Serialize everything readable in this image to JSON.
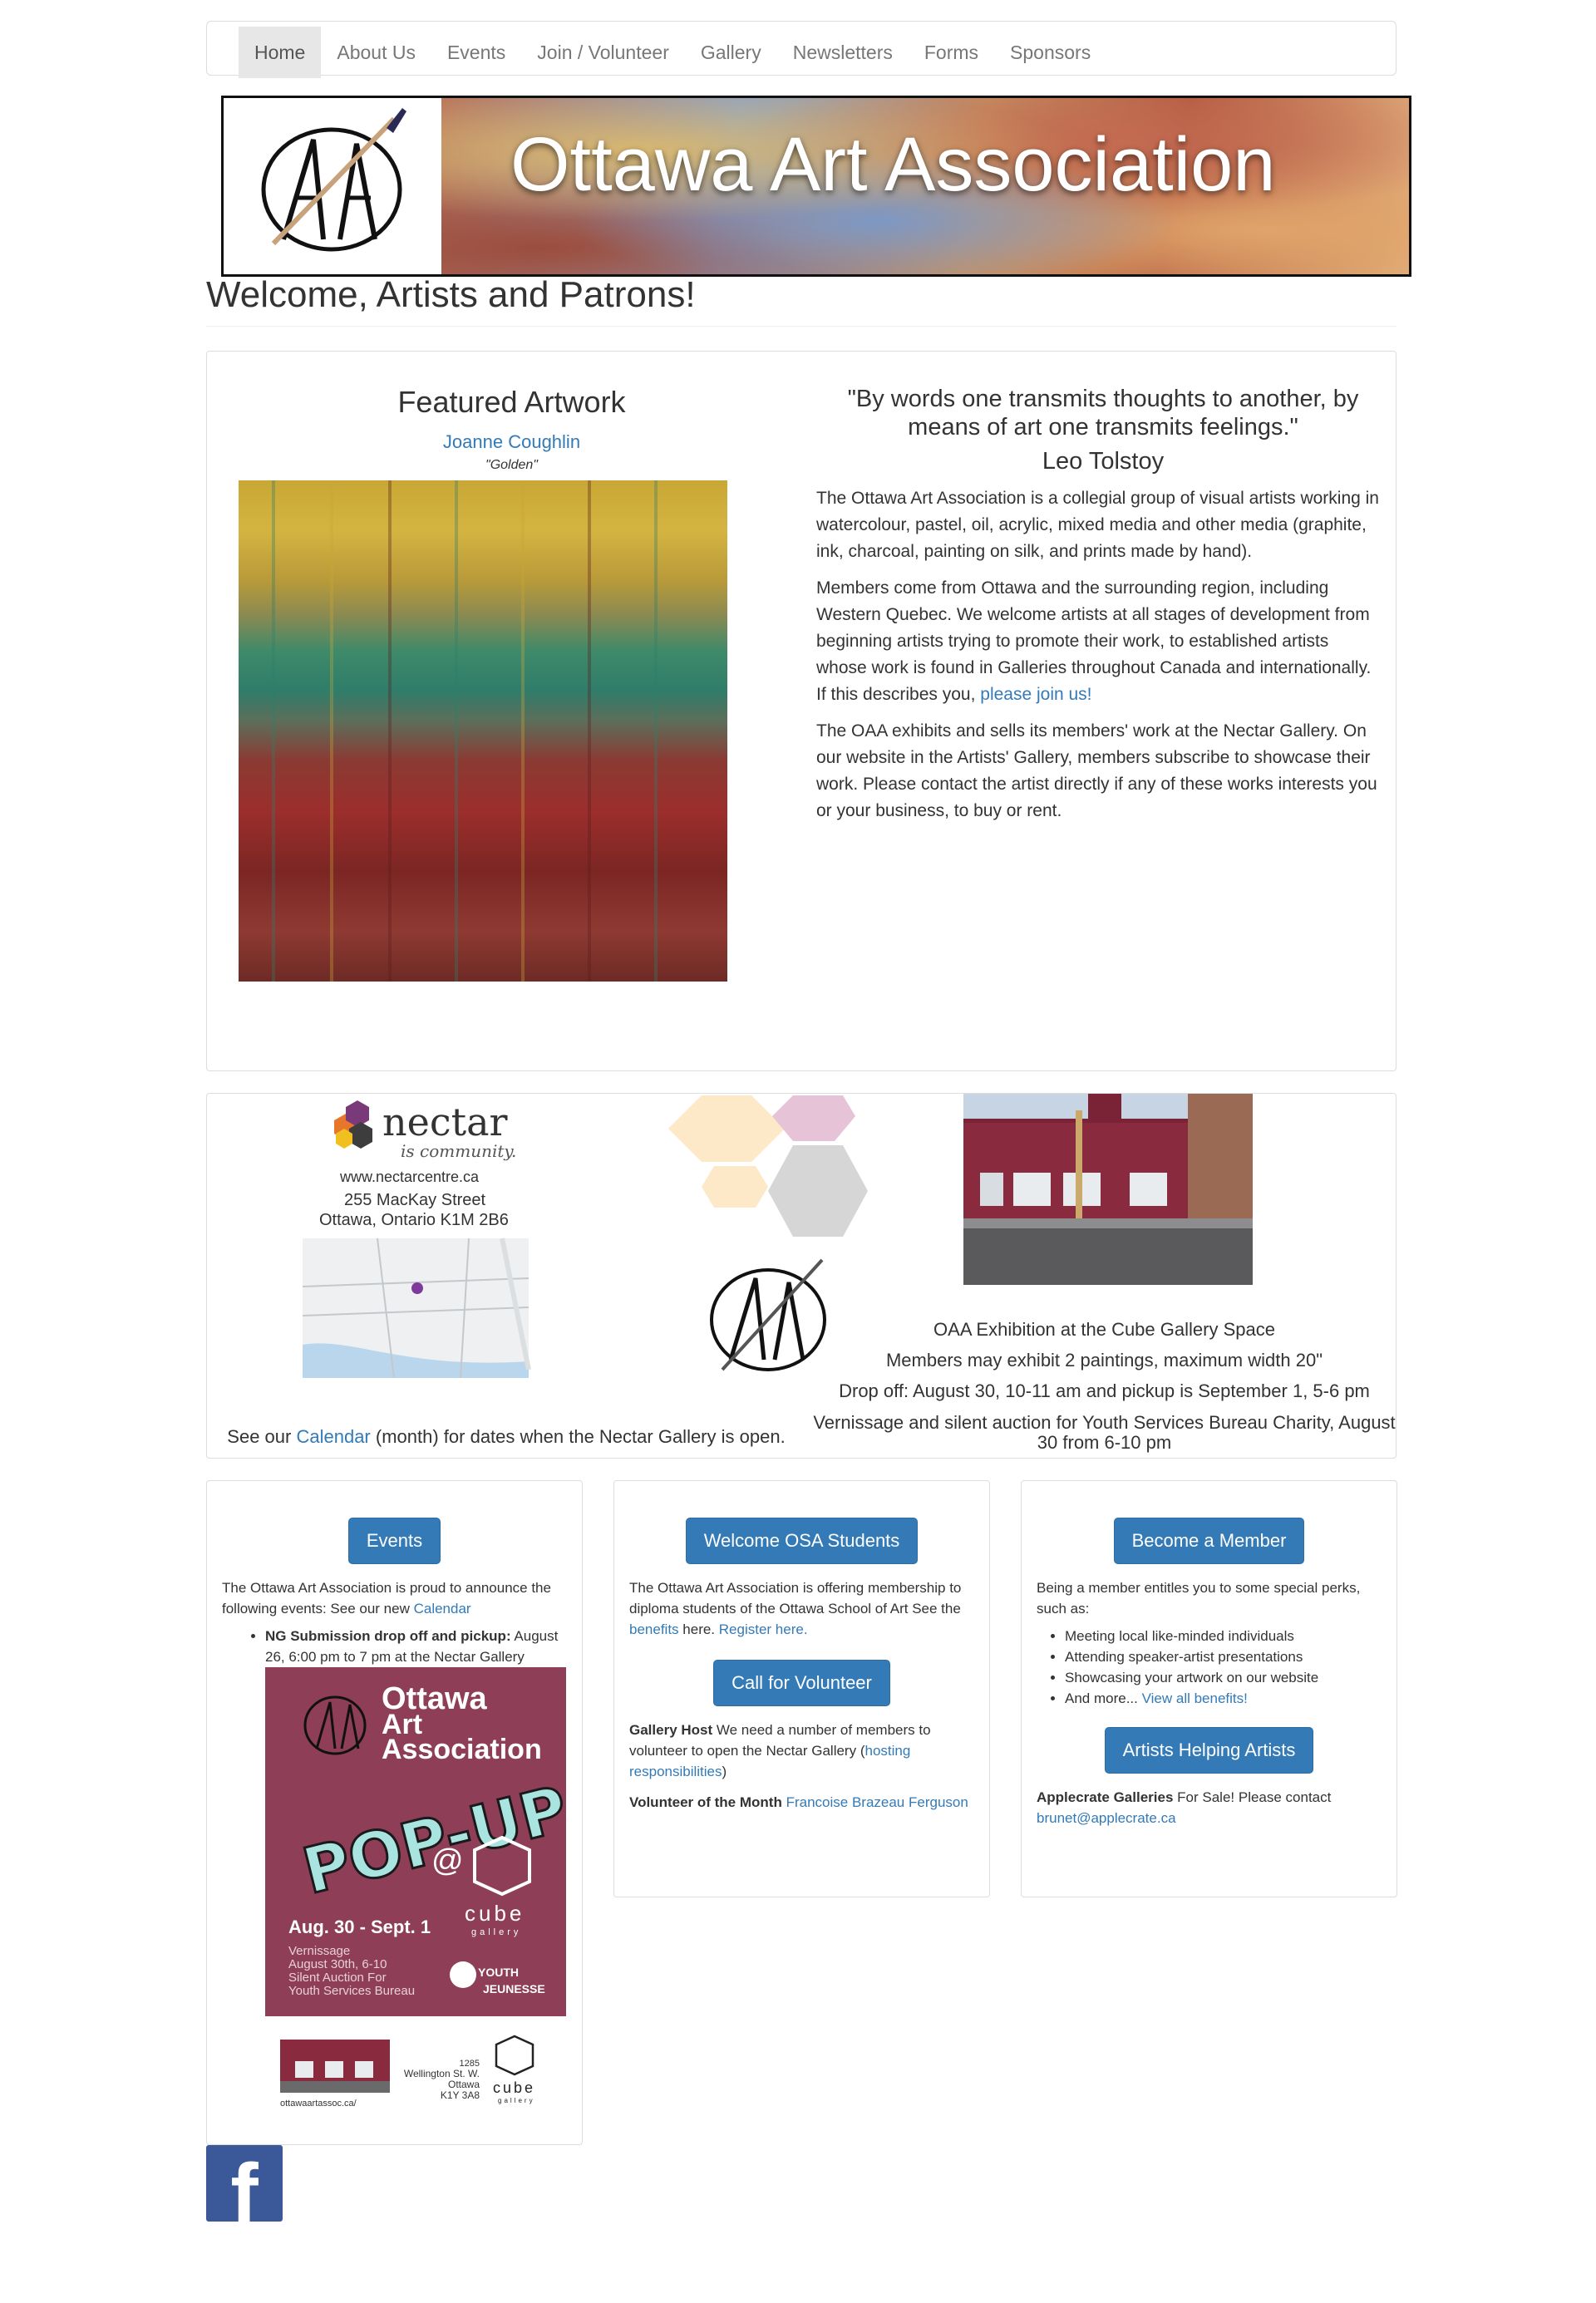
{
  "nav": {
    "items": [
      {
        "label": "Home"
      },
      {
        "label": "About Us"
      },
      {
        "label": "Events"
      },
      {
        "label": "Join / Volunteer"
      },
      {
        "label": "Gallery"
      },
      {
        "label": "Newsletters"
      },
      {
        "label": "Forms"
      },
      {
        "label": "Sponsors"
      }
    ],
    "active": "Home"
  },
  "banner": {
    "title": "Ottawa Art Association"
  },
  "page": {
    "title": "Welcome, Artists and Patrons!"
  },
  "featured": {
    "heading": "Featured Artwork",
    "artist": "Joanne Coughlin",
    "art_title": "\"Golden\""
  },
  "quote": {
    "text": "\"By words one transmits thoughts to another, by means of art one transmits feelings.\"",
    "author": "Leo Tolstoy"
  },
  "about": {
    "p1": "The Ottawa Art Association is a collegial group of visual artists working in watercolour, pastel, oil, acrylic, mixed media and other media (graphite, ink, charcoal, painting on silk, and prints made by hand).",
    "p2": "Members come from Ottawa and the surrounding region, including Western Quebec. We welcome artists at all stages of development from beginning artists trying to promote their work, to established artists whose work is found in Galleries throughout Canada and internationally. If this describes you,",
    "p2_link": "please join us!",
    "p3": "The OAA exhibits and sells its members' work at the Nectar Gallery. On our website in the Artists' Gallery, members subscribe to showcase their work. Please contact the artist directly if any of these works interests you or your business, to buy or rent."
  },
  "nectar": {
    "brand": "nectar",
    "tagline": "is community.",
    "url": "www.nectarcentre.ca",
    "street": "255 MacKay Street",
    "city": "Ottawa, Ontario  K1M 2B6",
    "caption_pre": "See our",
    "caption_link": "Calendar",
    "caption_post": "(month) for dates when the Nectar Gallery is open."
  },
  "cube": {
    "line1": "OAA Exhibition at the Cube Gallery Space",
    "line2": "Members may exhibit 2 paintings, maximum width 20\"",
    "line3": "Drop off: August 30, 10-11 am and pickup is September 1, 5-6 pm",
    "line4": "Vernissage and silent auction for Youth Services Bureau Charity, August 30 from 6-10 pm"
  },
  "events": {
    "button": "Events",
    "text": "The Ottawa Art Association is proud to announce the following events: See our new",
    "calendar_link": "Calendar",
    "item_bold": "NG Submission drop off and pickup:",
    "item_rest": "August 26, 6:00 pm to 7 pm at the Nectar Gallery",
    "poster": {
      "title_line1": "Ottawa",
      "title_line2": "Art",
      "title_line3": "Association",
      "popup": "POP-UP",
      "at": "@",
      "cube": "cube",
      "cube_sub": "gallery",
      "dates": "Aug. 30 - Sept. 1",
      "details1": "Vernissage",
      "details2": "August 30th, 6-10",
      "details3": "Silent Auction For",
      "details4": "Youth Services Bureau",
      "youth": "YOUTH",
      "jeunesse": "JEUNESSE",
      "address1": "1285",
      "address2": "Wellington St. W.",
      "address3": "Ottawa",
      "address4": "K1Y 3A8",
      "site": "ottawaartassoc.ca/"
    }
  },
  "osa": {
    "button": "Welcome OSA Students",
    "text": "The Ottawa Art Association is offering membership to diploma students of the Ottawa School of Art See the",
    "benefits_link": "benefits",
    "text_mid": "here.",
    "register_link": "Register here.",
    "volunteer_button": "Call for Volunteer",
    "host_bold": "Gallery Host",
    "host_text": "We need a number of members to volunteer to open the Nectar Gallery (",
    "host_link": "hosting responsibilities",
    "host_close": ")",
    "votm_bold": "Volunteer of the Month",
    "votm_link": "Francoise Brazeau Ferguson"
  },
  "member": {
    "button": "Become a Member",
    "text": "Being a member entitles you to some special perks, such as:",
    "perks": [
      "Meeting local like-minded individuals",
      "Attending speaker-artist presentations",
      "Showcasing your artwork on our website"
    ],
    "more": "And more...",
    "more_link": "View all benefits!",
    "aha_button": "Artists Helping Artists",
    "applecrate_bold": "Applecrate Galleries",
    "applecrate_text": "For Sale! Please contact",
    "applecrate_email": "brunet@applecrate.ca"
  },
  "social": {
    "icon": "facebook-icon",
    "letter": "f"
  },
  "colors": {
    "link": "#337ab7",
    "button": "#337ab7",
    "poster": "#8e3e57",
    "facebook": "#3b5998"
  }
}
